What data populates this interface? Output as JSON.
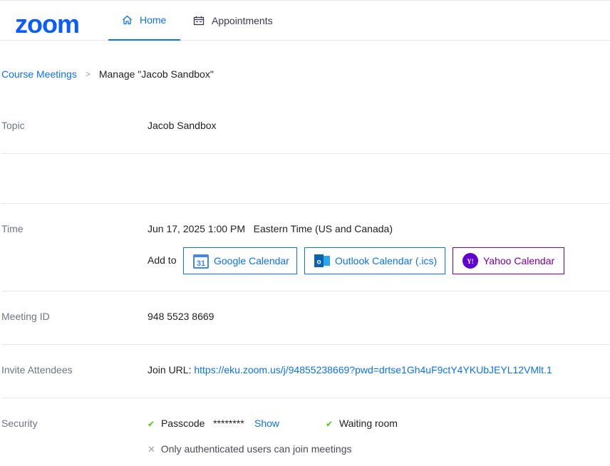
{
  "brand": {
    "logo_text": "zoom",
    "color": "#0B5CFF"
  },
  "nav": {
    "tabs": [
      {
        "label": "Home",
        "icon": "home-icon",
        "active": true
      },
      {
        "label": "Appointments",
        "icon": "calendar-icon",
        "active": false
      }
    ]
  },
  "breadcrumb": {
    "parent": "Course Meetings",
    "separator": ">",
    "current": "Manage \"Jacob Sandbox\""
  },
  "topic": {
    "label": "Topic",
    "value": "Jacob Sandbox"
  },
  "time": {
    "label": "Time",
    "datetime": "Jun 17, 2025 1:00 PM",
    "timezone": "Eastern Time (US and Canada)",
    "add_to_label": "Add to",
    "google": {
      "label": "Google Calendar",
      "icon_text": "31"
    },
    "outlook": {
      "label": "Outlook Calendar (.ics)",
      "icon_text": "o"
    },
    "yahoo": {
      "label": "Yahoo Calendar",
      "icon_text": "Y!"
    }
  },
  "meeting_id": {
    "label": "Meeting ID",
    "value": "948 5523 8669"
  },
  "invite": {
    "label": "Invite Attendees",
    "join_label": "Join URL:",
    "url": "https://eku.zoom.us/j/94855238669?pwd=drtse1Gh4uF9ctY4YKUbJEYL12VMlt.1"
  },
  "security": {
    "label": "Security",
    "passcode_label": "Passcode",
    "passcode_mask": "********",
    "show_label": "Show",
    "waiting_room_label": "Waiting room",
    "auth_only_label": "Only authenticated users can join meetings"
  },
  "colors": {
    "accent": "#0e72ed",
    "yahoo": "#7b0099",
    "check": "#52c41a",
    "label_gray": "#6e7680",
    "divider": "#e6e6e6"
  }
}
